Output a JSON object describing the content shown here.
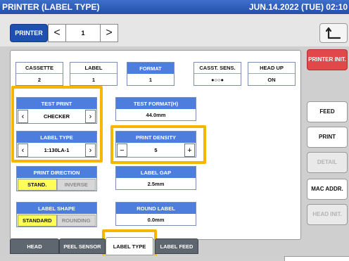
{
  "header": {
    "title": "PRINTER (LABEL TYPE)",
    "datetime": "JUN.14.2022 (TUE) 02:10"
  },
  "nav": {
    "printer_label": "PRINTER",
    "page_value": "1",
    "prev": "<",
    "next": ">"
  },
  "status": [
    {
      "label": "CASSETTE",
      "value": "2"
    },
    {
      "label": "LABEL",
      "value": "1"
    },
    {
      "label": "FORMAT",
      "value": "1"
    },
    {
      "label": "CASST. SENS.",
      "value": "●○○●"
    },
    {
      "label": "HEAD UP",
      "value": "ON"
    }
  ],
  "test_print": {
    "label": "TEST PRINT",
    "value": "CHECKER"
  },
  "test_format": {
    "label": "TEST FORMAT(H)",
    "value": "44.0mm"
  },
  "label_type": {
    "label": "LABEL TYPE",
    "value": "1:130LA-1"
  },
  "print_density": {
    "label": "PRINT DENSITY",
    "value": "5",
    "minus": "−",
    "plus": "+"
  },
  "print_direction": {
    "label": "PRINT DIRECTION",
    "options": [
      "STAND.",
      "INVERSE"
    ],
    "selected": "STAND."
  },
  "label_gap": {
    "label": "LABEL GAP",
    "value": "2.5mm"
  },
  "label_shape": {
    "label": "LABEL SHAPE",
    "options": [
      "STANDARD",
      "ROUNDING"
    ],
    "selected": "STANDARD"
  },
  "round_label": {
    "label": "ROUND LABEL",
    "value": "0.0mm"
  },
  "side_buttons": {
    "printer_init": "PRINTER INIT.",
    "feed": "FEED",
    "print": "PRINT",
    "detail": "DETAIL",
    "mac_addr": "MAC ADDR.",
    "head_init": "HEAD INIT."
  },
  "tabs": [
    "HEAD",
    "PEEL SENSOR",
    "LABEL TYPE",
    "LABEL FEED"
  ],
  "active_tab": "LABEL TYPE",
  "colors": {
    "accent_blue": "#4d7ede",
    "highlight": "#f7b500",
    "toggle_on": "#ffff55",
    "init_red": "#e1484a"
  }
}
